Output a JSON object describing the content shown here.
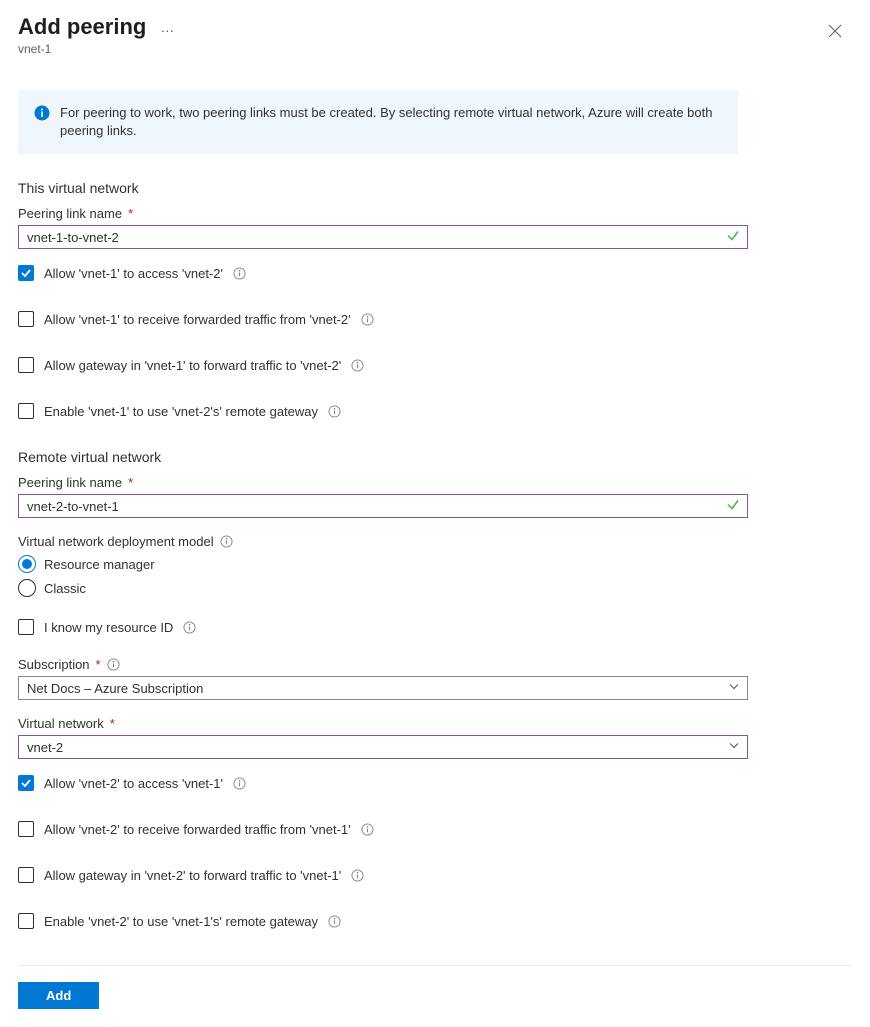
{
  "header": {
    "title": "Add peering",
    "subtitle": "vnet-1"
  },
  "info_message": "For peering to work, two peering links must be created. By selecting remote virtual network, Azure will create both peering links.",
  "this_network": {
    "section": "This virtual network",
    "link_name_label": "Peering link name",
    "link_name_value": "vnet-1-to-vnet-2",
    "opts": [
      {
        "label": "Allow 'vnet-1' to access 'vnet-2'",
        "checked": true
      },
      {
        "label": "Allow 'vnet-1' to receive forwarded traffic from 'vnet-2'",
        "checked": false
      },
      {
        "label": "Allow gateway in 'vnet-1' to forward traffic to 'vnet-2'",
        "checked": false
      },
      {
        "label": "Enable 'vnet-1' to use 'vnet-2's' remote gateway",
        "checked": false
      }
    ]
  },
  "remote_network": {
    "section": "Remote virtual network",
    "link_name_label": "Peering link name",
    "link_name_value": "vnet-2-to-vnet-1",
    "deploy_model_label": "Virtual network deployment model",
    "deploy_model_options": {
      "rm": "Resource manager",
      "classic": "Classic"
    },
    "know_id_label": "I know my resource ID",
    "subscription_label": "Subscription",
    "subscription_value": "Net Docs – Azure Subscription",
    "vnet_label": "Virtual network",
    "vnet_value": "vnet-2",
    "opts": [
      {
        "label": "Allow 'vnet-2' to access 'vnet-1'",
        "checked": true
      },
      {
        "label": "Allow 'vnet-2' to receive forwarded traffic from 'vnet-1'",
        "checked": false
      },
      {
        "label": "Allow gateway in 'vnet-2' to forward traffic to 'vnet-1'",
        "checked": false
      },
      {
        "label": "Enable 'vnet-2' to use 'vnet-1's' remote gateway",
        "checked": false
      }
    ]
  },
  "footer": {
    "add_label": "Add"
  }
}
